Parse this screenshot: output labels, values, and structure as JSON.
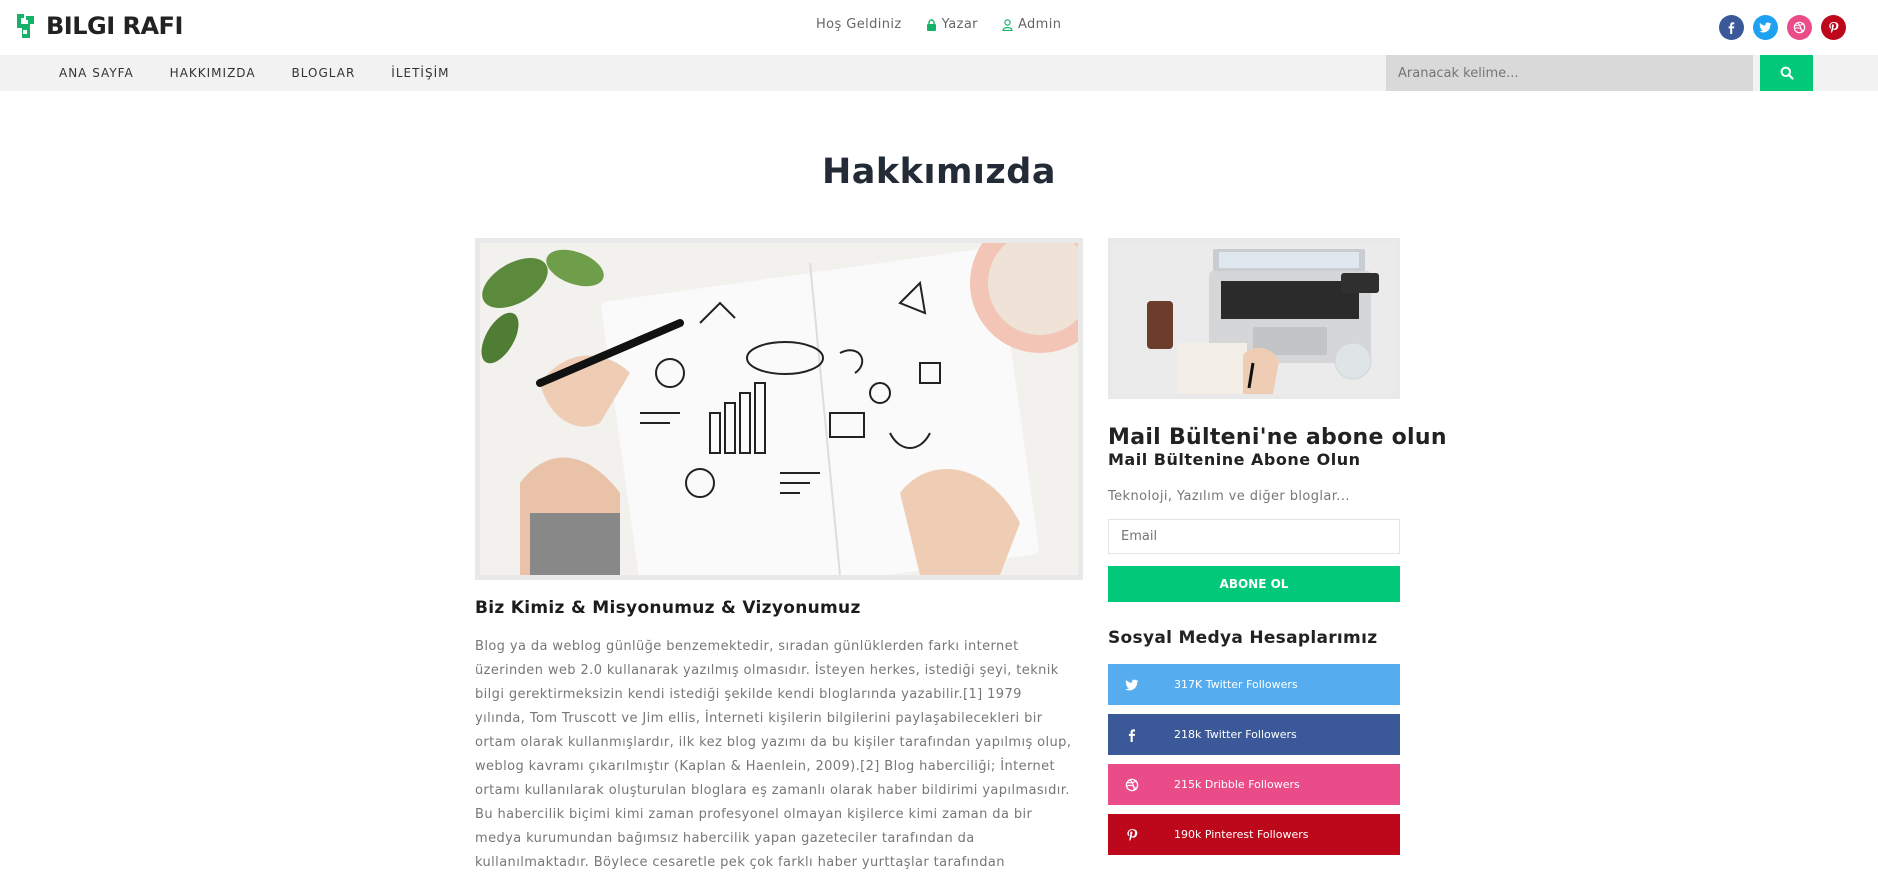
{
  "brand": {
    "name": "BILGI RAFI"
  },
  "top_nav": [
    {
      "label": "Hoş Geldiniz",
      "icon": ""
    },
    {
      "label": "Yazar",
      "icon": "lock-icon"
    },
    {
      "label": "Admin",
      "icon": "user-icon"
    }
  ],
  "top_socials": [
    {
      "name": "facebook-icon",
      "color": "#3b5998"
    },
    {
      "name": "twitter-icon",
      "color": "#1da1f2"
    },
    {
      "name": "dribbble-icon",
      "color": "#ea4c89"
    },
    {
      "name": "pinterest-icon",
      "color": "#bd081c"
    }
  ],
  "menu": [
    "ANA SAYFA",
    "HAKKIMIZDA",
    "BLOGLAR",
    "İLETİŞİM"
  ],
  "search": {
    "placeholder": "Aranacak kelime..."
  },
  "page": {
    "title": "Hakkımızda",
    "section_title": "Biz Kimiz & Misyonumuz & Vizyonumuz",
    "body": "Blog ya da weblog günlüğe benzemektedir, sıradan günlüklerden farkı internet üzerinden web 2.0 kullanarak yazılmış olmasıdır. İsteyen herkes, istediği şeyi, teknik bilgi gerektirmeksizin kendi istediği şekilde kendi bloglarında yazabilir.[1] 1979 yılında, Tom Truscott ve Jim ellis, İnterneti kişilerin bilgilerini paylaşabilecekleri bir ortam olarak kullanmışlardır, ilk kez blog yazımı da bu kişiler tarafından yapılmış olup, weblog kavramı çıkarılmıştır (Kaplan & Haenlein, 2009).[2] Blog haberciliği; İnternet ortamı kullanılarak oluşturulan bloglara eş zamanlı olarak haber bildirimi yapılmasıdır. Bu habercilik biçimi kimi zaman profesyonel olmayan kişilerce kimi zaman da bir medya kurumundan bağımsız habercilik yapan gazeteciler tarafından da kullanılmaktadır. Böylece cesaretle pek çok farklı haber yurttaşlar tarafından bloglarında paylaşılmaktadır. Luke Goode'a"
  },
  "newsletter": {
    "title": "Mail Bülteni'ne abone olun",
    "subtitle": "Mail Bültenine Abone Olun",
    "description": "Teknoloji, Yazılım ve diğer bloglar...",
    "email_placeholder": "Email",
    "button_label": "ABONE OL"
  },
  "social": {
    "title": "Sosyal Medya Hesaplarımız",
    "items": [
      {
        "icon": "twitter-icon",
        "label": "317K Twitter Followers",
        "color": "#55acee"
      },
      {
        "icon": "facebook-icon",
        "label": "218k Twitter Followers",
        "color": "#3b5998"
      },
      {
        "icon": "dribbble-icon",
        "label": "215k Dribble Followers",
        "color": "#ea4c89"
      },
      {
        "icon": "pinterest-icon",
        "label": "190k Pinterest Followers",
        "color": "#bd081c"
      }
    ]
  },
  "colors": {
    "accent": "#02c97a",
    "title": "#232b36"
  }
}
